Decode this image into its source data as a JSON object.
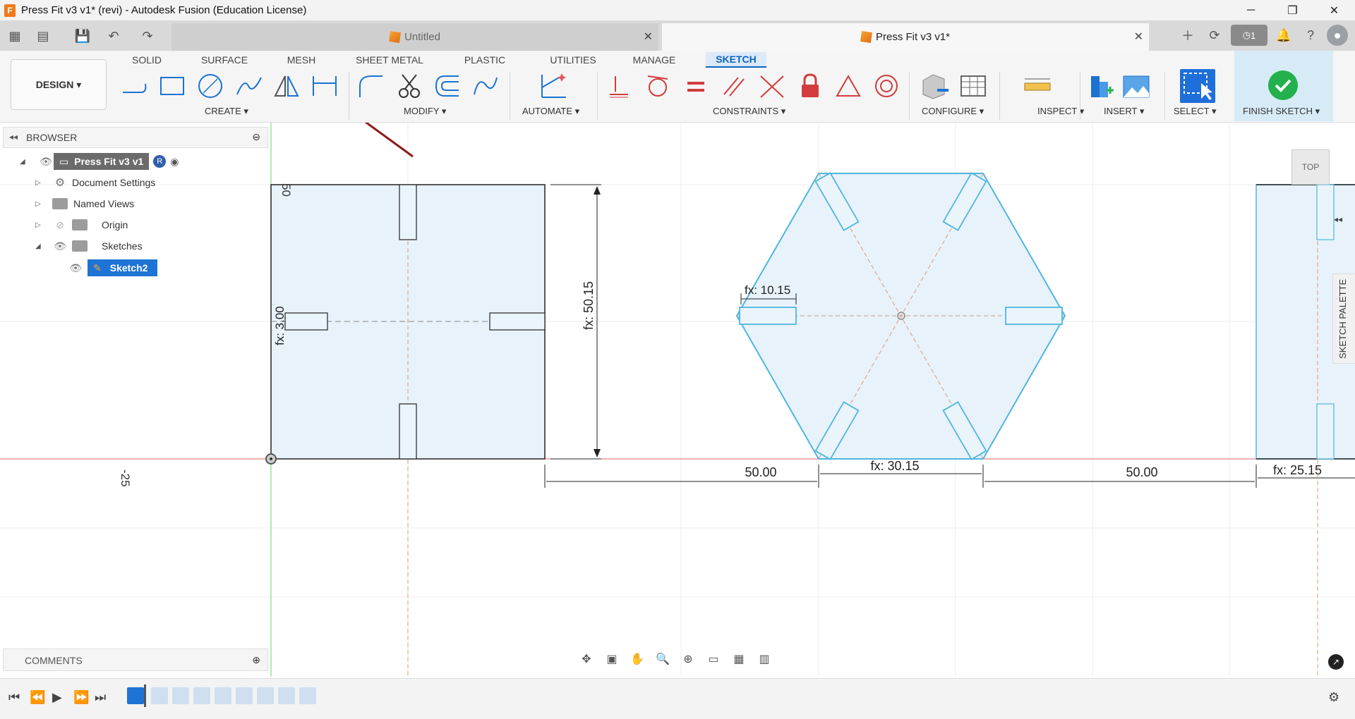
{
  "window": {
    "title": "Press Fit v3 v1* (revi) - Autodesk Fusion (Education License)",
    "app_icon_letter": "F",
    "controls": [
      "─",
      "❐",
      "✕"
    ]
  },
  "tabs": {
    "inactive_label": "Untitled",
    "active_label": "Press Fit v3 v1*",
    "notification_count": "1"
  },
  "ribbon": {
    "workspace": "DESIGN ▾",
    "tabs": [
      "SOLID",
      "SURFACE",
      "MESH",
      "SHEET METAL",
      "PLASTIC",
      "UTILITIES",
      "MANAGE",
      "SKETCH"
    ],
    "groups": {
      "create": "CREATE ▾",
      "modify": "MODIFY ▾",
      "automate": "AUTOMATE ▾",
      "constraints": "CONSTRAINTS ▾",
      "configure": "CONFIGURE ▾",
      "inspect": "INSPECT ▾",
      "insert": "INSERT ▾",
      "select": "SELECT ▾",
      "finish": "FINISH SKETCH ▾"
    },
    "accent": "#0a66c2",
    "finish_color": "#22b14c"
  },
  "browser": {
    "title": "BROWSER",
    "root": "Press Fit v3 v1",
    "items": [
      "Document Settings",
      "Named Views",
      "Origin",
      "Sketches"
    ],
    "sketch": "Sketch2"
  },
  "comments": {
    "title": "COMMENTS"
  },
  "viewcube": {
    "label": "TOP"
  },
  "sketch_palette": {
    "label": "SKETCH PALETTE"
  },
  "canvas": {
    "axis_labels": {
      "top_y": "50",
      "left_x": "-25"
    },
    "dims": {
      "slot_width_left": "fx: 3.00",
      "height": "fx: 50.15",
      "hex_slot": "fx: 10.15",
      "gap_1": "50.00",
      "hex_side": "fx: 30.15",
      "gap_2": "50.00",
      "right_part": "fx: 25.15"
    },
    "colors": {
      "fill": "#e8f2fa",
      "sketch_line": "#4fb6e0",
      "red_axis": "#e06060",
      "green_axis": "#6cd06c",
      "arrow": "#8b1a1a"
    }
  }
}
